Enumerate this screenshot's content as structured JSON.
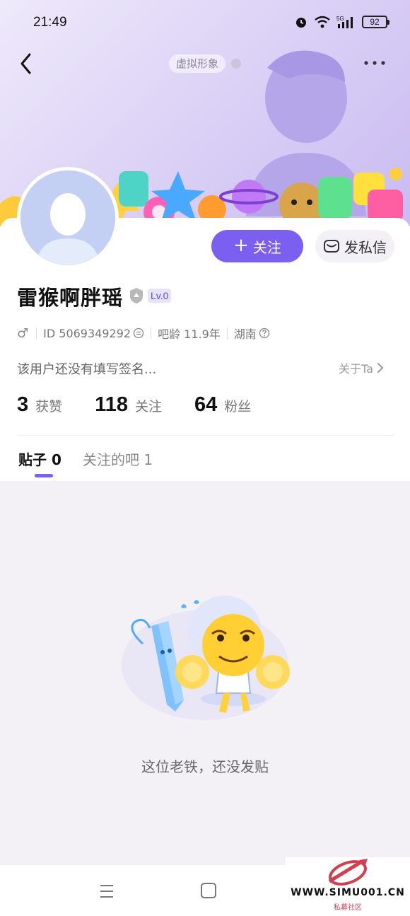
{
  "status_bar": {
    "time": "21:49",
    "network": "5G",
    "battery": "92"
  },
  "header": {
    "avatar_chip": "虚拟形象",
    "icons": {
      "back": "chevron-left-icon",
      "more": "more-horizontal-icon"
    }
  },
  "profile": {
    "username": "雷猴啊胖瑶",
    "level": "Lv.0",
    "gender_symbol": "♂",
    "id_text": "ID 5069349292",
    "bar_age": "吧龄 11.9年",
    "location": "湖南",
    "signature": "该用户还没有填写签名...",
    "about_label": "关于Ta"
  },
  "actions": {
    "follow_label": "关注",
    "follow_plus": "+",
    "message_label": "发私信"
  },
  "stats": [
    {
      "value": "3",
      "label": "获赞"
    },
    {
      "value": "118",
      "label": "关注"
    },
    {
      "value": "64",
      "label": "粉丝"
    }
  ],
  "tabs": [
    {
      "label": "贴子 0",
      "active": true
    },
    {
      "label": "关注的吧 1",
      "active": false
    }
  ],
  "empty_state": {
    "text": "这位老铁，还没发贴"
  },
  "watermark": {
    "site": "WWW.SIMU001.CN",
    "sub": "私募社区"
  },
  "colors": {
    "accent": "#7b5ff1",
    "banner": "#ddd4f6",
    "content_bg": "#f4f1f6"
  }
}
